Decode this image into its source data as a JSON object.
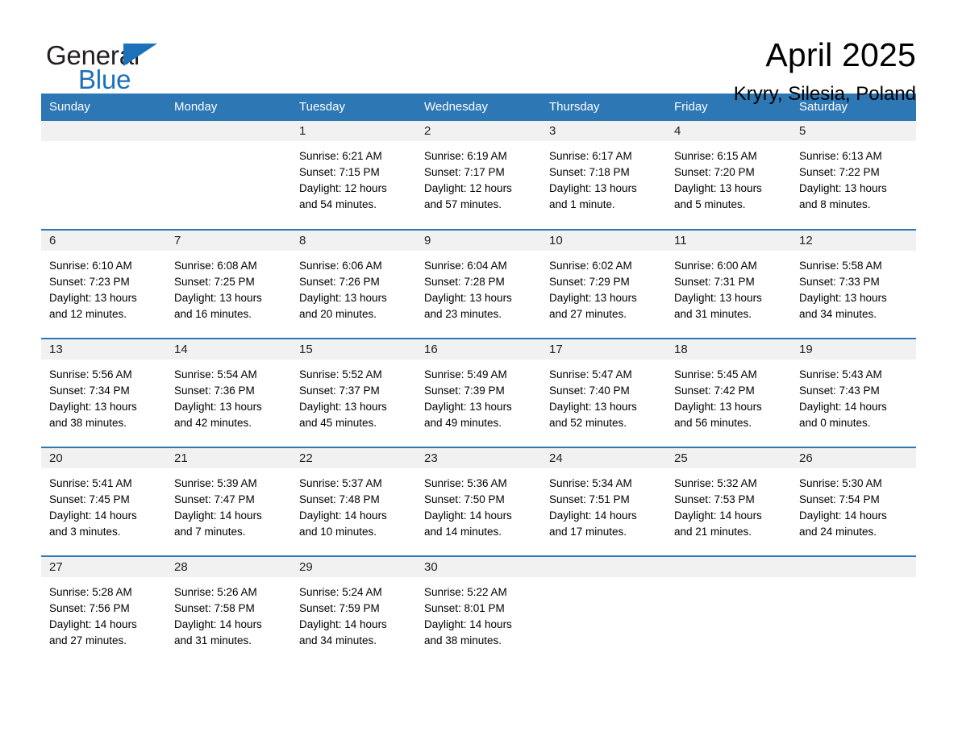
{
  "brand": {
    "name_part1": "General",
    "name_part2": "Blue",
    "triangle_color": "#1b72b8",
    "accent_color": "#2e77b5"
  },
  "header": {
    "month_title": "April 2025",
    "location": "Kryry, Silesia, Poland"
  },
  "calendar": {
    "weekday_headers": [
      "Sunday",
      "Monday",
      "Tuesday",
      "Wednesday",
      "Thursday",
      "Friday",
      "Saturday"
    ],
    "header_bg": "#2e77b5",
    "daynum_bg": "#f1f1f1",
    "row_divider_color": "#2e77b5",
    "weeks": [
      [
        {
          "day": "",
          "empty": true
        },
        {
          "day": "",
          "empty": true
        },
        {
          "day": "1",
          "sunrise": "Sunrise: 6:21 AM",
          "sunset": "Sunset: 7:15 PM",
          "daylight_line1": "Daylight: 12 hours",
          "daylight_line2": "and 54 minutes."
        },
        {
          "day": "2",
          "sunrise": "Sunrise: 6:19 AM",
          "sunset": "Sunset: 7:17 PM",
          "daylight_line1": "Daylight: 12 hours",
          "daylight_line2": "and 57 minutes."
        },
        {
          "day": "3",
          "sunrise": "Sunrise: 6:17 AM",
          "sunset": "Sunset: 7:18 PM",
          "daylight_line1": "Daylight: 13 hours",
          "daylight_line2": "and 1 minute."
        },
        {
          "day": "4",
          "sunrise": "Sunrise: 6:15 AM",
          "sunset": "Sunset: 7:20 PM",
          "daylight_line1": "Daylight: 13 hours",
          "daylight_line2": "and 5 minutes."
        },
        {
          "day": "5",
          "sunrise": "Sunrise: 6:13 AM",
          "sunset": "Sunset: 7:22 PM",
          "daylight_line1": "Daylight: 13 hours",
          "daylight_line2": "and 8 minutes."
        }
      ],
      [
        {
          "day": "6",
          "sunrise": "Sunrise: 6:10 AM",
          "sunset": "Sunset: 7:23 PM",
          "daylight_line1": "Daylight: 13 hours",
          "daylight_line2": "and 12 minutes."
        },
        {
          "day": "7",
          "sunrise": "Sunrise: 6:08 AM",
          "sunset": "Sunset: 7:25 PM",
          "daylight_line1": "Daylight: 13 hours",
          "daylight_line2": "and 16 minutes."
        },
        {
          "day": "8",
          "sunrise": "Sunrise: 6:06 AM",
          "sunset": "Sunset: 7:26 PM",
          "daylight_line1": "Daylight: 13 hours",
          "daylight_line2": "and 20 minutes."
        },
        {
          "day": "9",
          "sunrise": "Sunrise: 6:04 AM",
          "sunset": "Sunset: 7:28 PM",
          "daylight_line1": "Daylight: 13 hours",
          "daylight_line2": "and 23 minutes."
        },
        {
          "day": "10",
          "sunrise": "Sunrise: 6:02 AM",
          "sunset": "Sunset: 7:29 PM",
          "daylight_line1": "Daylight: 13 hours",
          "daylight_line2": "and 27 minutes."
        },
        {
          "day": "11",
          "sunrise": "Sunrise: 6:00 AM",
          "sunset": "Sunset: 7:31 PM",
          "daylight_line1": "Daylight: 13 hours",
          "daylight_line2": "and 31 minutes."
        },
        {
          "day": "12",
          "sunrise": "Sunrise: 5:58 AM",
          "sunset": "Sunset: 7:33 PM",
          "daylight_line1": "Daylight: 13 hours",
          "daylight_line2": "and 34 minutes."
        }
      ],
      [
        {
          "day": "13",
          "sunrise": "Sunrise: 5:56 AM",
          "sunset": "Sunset: 7:34 PM",
          "daylight_line1": "Daylight: 13 hours",
          "daylight_line2": "and 38 minutes."
        },
        {
          "day": "14",
          "sunrise": "Sunrise: 5:54 AM",
          "sunset": "Sunset: 7:36 PM",
          "daylight_line1": "Daylight: 13 hours",
          "daylight_line2": "and 42 minutes."
        },
        {
          "day": "15",
          "sunrise": "Sunrise: 5:52 AM",
          "sunset": "Sunset: 7:37 PM",
          "daylight_line1": "Daylight: 13 hours",
          "daylight_line2": "and 45 minutes."
        },
        {
          "day": "16",
          "sunrise": "Sunrise: 5:49 AM",
          "sunset": "Sunset: 7:39 PM",
          "daylight_line1": "Daylight: 13 hours",
          "daylight_line2": "and 49 minutes."
        },
        {
          "day": "17",
          "sunrise": "Sunrise: 5:47 AM",
          "sunset": "Sunset: 7:40 PM",
          "daylight_line1": "Daylight: 13 hours",
          "daylight_line2": "and 52 minutes."
        },
        {
          "day": "18",
          "sunrise": "Sunrise: 5:45 AM",
          "sunset": "Sunset: 7:42 PM",
          "daylight_line1": "Daylight: 13 hours",
          "daylight_line2": "and 56 minutes."
        },
        {
          "day": "19",
          "sunrise": "Sunrise: 5:43 AM",
          "sunset": "Sunset: 7:43 PM",
          "daylight_line1": "Daylight: 14 hours",
          "daylight_line2": "and 0 minutes."
        }
      ],
      [
        {
          "day": "20",
          "sunrise": "Sunrise: 5:41 AM",
          "sunset": "Sunset: 7:45 PM",
          "daylight_line1": "Daylight: 14 hours",
          "daylight_line2": "and 3 minutes."
        },
        {
          "day": "21",
          "sunrise": "Sunrise: 5:39 AM",
          "sunset": "Sunset: 7:47 PM",
          "daylight_line1": "Daylight: 14 hours",
          "daylight_line2": "and 7 minutes."
        },
        {
          "day": "22",
          "sunrise": "Sunrise: 5:37 AM",
          "sunset": "Sunset: 7:48 PM",
          "daylight_line1": "Daylight: 14 hours",
          "daylight_line2": "and 10 minutes."
        },
        {
          "day": "23",
          "sunrise": "Sunrise: 5:36 AM",
          "sunset": "Sunset: 7:50 PM",
          "daylight_line1": "Daylight: 14 hours",
          "daylight_line2": "and 14 minutes."
        },
        {
          "day": "24",
          "sunrise": "Sunrise: 5:34 AM",
          "sunset": "Sunset: 7:51 PM",
          "daylight_line1": "Daylight: 14 hours",
          "daylight_line2": "and 17 minutes."
        },
        {
          "day": "25",
          "sunrise": "Sunrise: 5:32 AM",
          "sunset": "Sunset: 7:53 PM",
          "daylight_line1": "Daylight: 14 hours",
          "daylight_line2": "and 21 minutes."
        },
        {
          "day": "26",
          "sunrise": "Sunrise: 5:30 AM",
          "sunset": "Sunset: 7:54 PM",
          "daylight_line1": "Daylight: 14 hours",
          "daylight_line2": "and 24 minutes."
        }
      ],
      [
        {
          "day": "27",
          "sunrise": "Sunrise: 5:28 AM",
          "sunset": "Sunset: 7:56 PM",
          "daylight_line1": "Daylight: 14 hours",
          "daylight_line2": "and 27 minutes."
        },
        {
          "day": "28",
          "sunrise": "Sunrise: 5:26 AM",
          "sunset": "Sunset: 7:58 PM",
          "daylight_line1": "Daylight: 14 hours",
          "daylight_line2": "and 31 minutes."
        },
        {
          "day": "29",
          "sunrise": "Sunrise: 5:24 AM",
          "sunset": "Sunset: 7:59 PM",
          "daylight_line1": "Daylight: 14 hours",
          "daylight_line2": "and 34 minutes."
        },
        {
          "day": "30",
          "sunrise": "Sunrise: 5:22 AM",
          "sunset": "Sunset: 8:01 PM",
          "daylight_line1": "Daylight: 14 hours",
          "daylight_line2": "and 38 minutes."
        },
        {
          "day": "",
          "empty": true
        },
        {
          "day": "",
          "empty": true
        },
        {
          "day": "",
          "empty": true
        }
      ]
    ]
  }
}
